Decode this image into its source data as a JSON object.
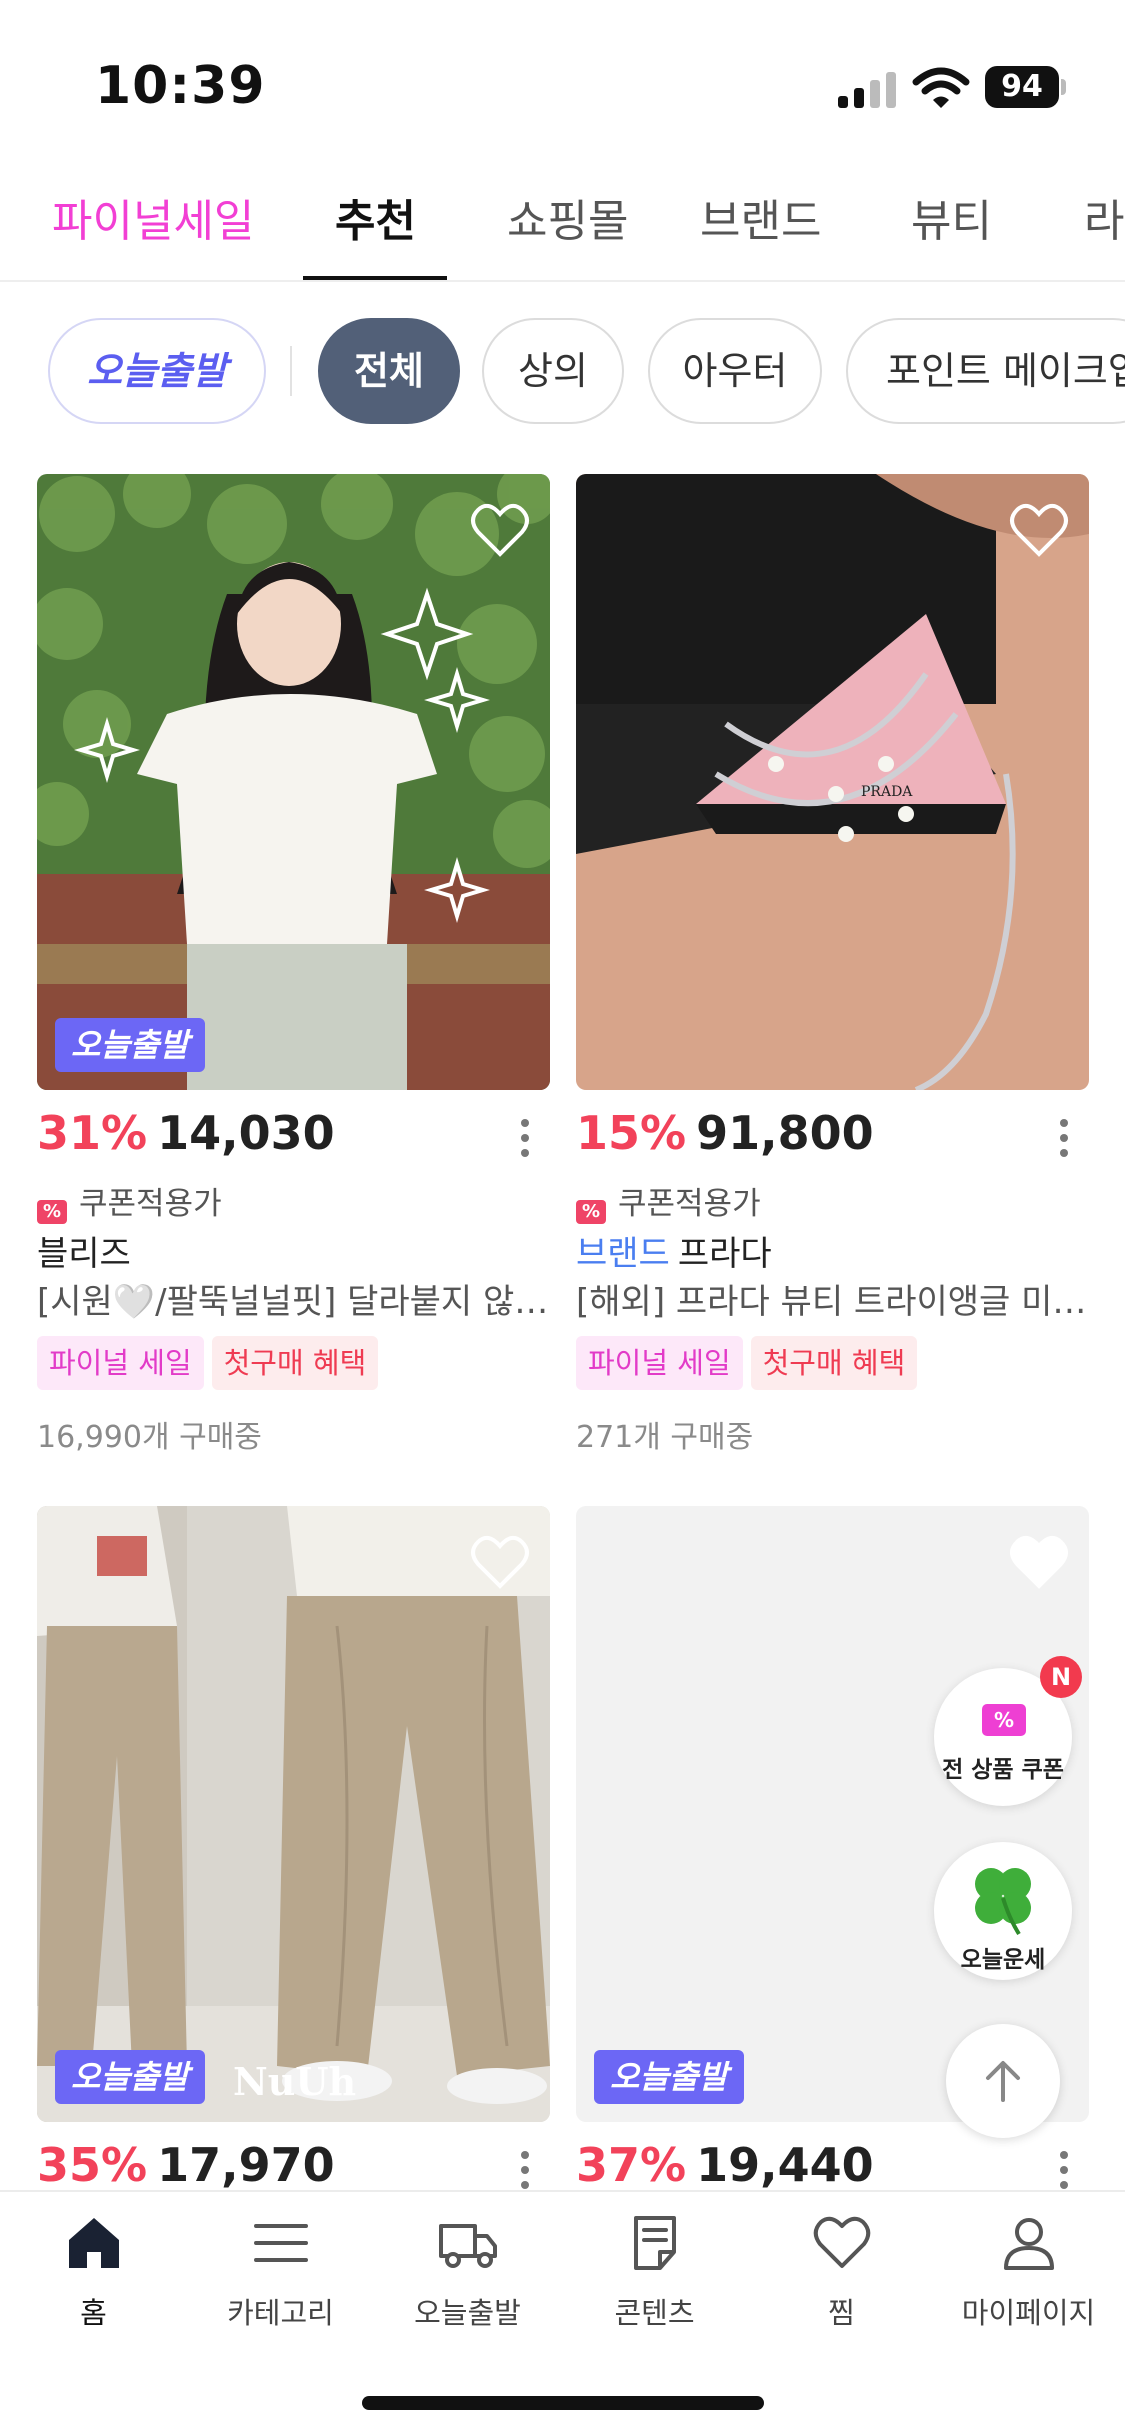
{
  "status_bar": {
    "time": "10:39",
    "battery": "94"
  },
  "top_tabs": [
    {
      "label": "파이널세일"
    },
    {
      "label": "추천"
    },
    {
      "label": "쇼핑몰"
    },
    {
      "label": "브랜드"
    },
    {
      "label": "뷰티"
    },
    {
      "label": "라"
    }
  ],
  "filter_chips": [
    {
      "label": "오늘출발"
    },
    {
      "label": "전체"
    },
    {
      "label": "상의"
    },
    {
      "label": "아우터"
    },
    {
      "label": "포인트 메이크업"
    }
  ],
  "products": [
    {
      "discount": "31%",
      "price": "14,030",
      "coupon": "쿠폰적용가",
      "brand_tag": "",
      "brand": "블리즈",
      "title": "[시원🤍/팔뚝널널핏] 달라붙지 않는 여름 반팔 블라우스",
      "tags": [
        "파이널 세일",
        "첫구매 혜택"
      ],
      "sold": "16,990개 구매중",
      "badge": "오늘출발"
    },
    {
      "discount": "15%",
      "price": "91,800",
      "coupon": "쿠폰적용가",
      "brand_tag": "브랜드",
      "brand": "프라다",
      "title": "[해외] 프라다 뷰티 트라이앵글 미니백",
      "tags": [
        "파이널 세일",
        "첫구매 혜택"
      ],
      "sold": "271개 구매중",
      "badge": ""
    },
    {
      "discount": "35%",
      "price": "17,970",
      "badge": "오늘출발",
      "image_logo": "NuUh"
    },
    {
      "discount": "37%",
      "price": "19,440",
      "badge": "오늘출발"
    }
  ],
  "floating": {
    "coupon_label": "전 상품 쿠폰",
    "coupon_badge": "N",
    "fortune_label": "오늘운세"
  },
  "bottom_nav": [
    {
      "label": "홈",
      "icon": "home-icon"
    },
    {
      "label": "카테고리",
      "icon": "menu-icon"
    },
    {
      "label": "오늘출발",
      "icon": "truck-icon"
    },
    {
      "label": "콘텐츠",
      "icon": "document-icon"
    },
    {
      "label": "찜",
      "icon": "heart-icon"
    },
    {
      "label": "마이페이지",
      "icon": "person-icon"
    }
  ],
  "colors": {
    "sale_pink": "#f23fd4",
    "discount_red": "#f2425a",
    "today_purple": "#6c67f5",
    "chip_active": "#526078",
    "brand_blue": "#4a7ef0"
  }
}
